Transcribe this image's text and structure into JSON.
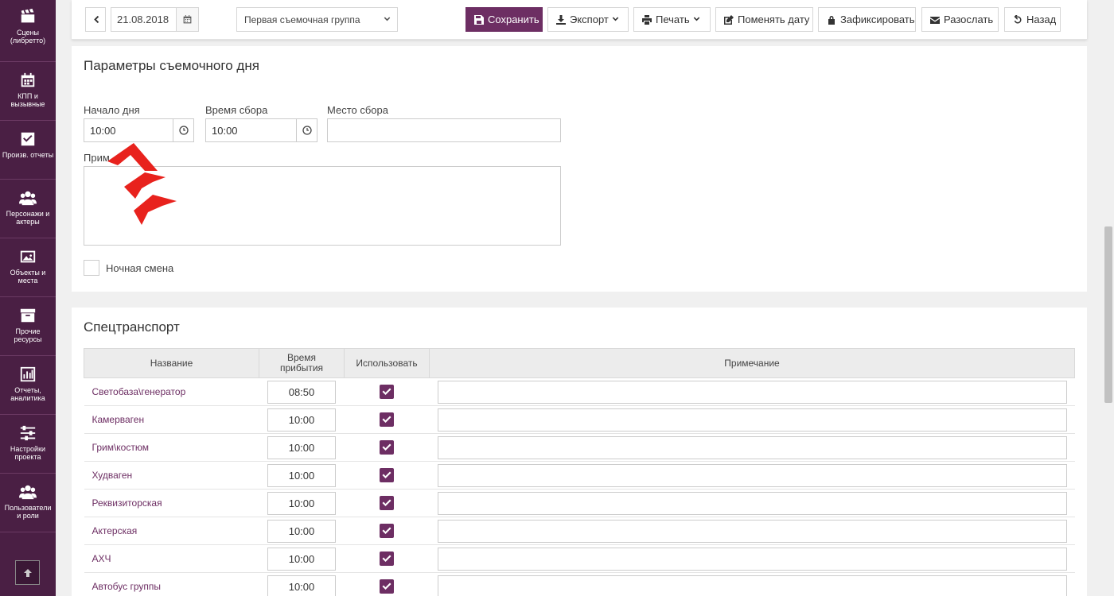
{
  "sidebar": {
    "items": [
      {
        "label": "Сцены (либретто)",
        "icon": "clapperboard-icon"
      },
      {
        "label": "КПП и вызывные",
        "icon": "calendar-icon"
      },
      {
        "label": "Произв. отчеты",
        "icon": "checkbox-icon"
      },
      {
        "label": "Персонажи и актеры",
        "icon": "users-icon"
      },
      {
        "label": "Объекты и места",
        "icon": "picture-icon"
      },
      {
        "label": "Прочие ресурсы",
        "icon": "archive-icon"
      },
      {
        "label": "Отчеты, аналитика",
        "icon": "bar-chart-icon"
      },
      {
        "label": "Настройки проекта",
        "icon": "sliders-icon"
      },
      {
        "label": "Пользователи и роли",
        "icon": "users-icon"
      }
    ]
  },
  "toolbar": {
    "date": "21.08.2018",
    "group": "Первая съемочная группа",
    "save": "Сохранить",
    "export": "Экспорт",
    "print": "Печать",
    "change_date": "Поменять дату",
    "lock": "Зафиксировать",
    "send": "Разослать",
    "back": "Назад"
  },
  "params": {
    "title": "Параметры съемочного дня",
    "start_label": "Начало дня",
    "start_value": "10:00",
    "gather_label": "Время сбора",
    "gather_value": "10:00",
    "place_label": "Место сбора",
    "place_value": "",
    "note_label": "Прим",
    "night_shift": "Ночная смена"
  },
  "transport": {
    "title": "Спецтранспорт",
    "columns": [
      "Название",
      "Время прибытия",
      "Использовать",
      "Примечание"
    ],
    "rows": [
      {
        "name": "Светобаза\\генератор",
        "time": "08:50",
        "use": true
      },
      {
        "name": "Камерваген",
        "time": "10:00",
        "use": true
      },
      {
        "name": "Грим\\костюм",
        "time": "10:00",
        "use": true
      },
      {
        "name": "Худваген",
        "time": "10:00",
        "use": true
      },
      {
        "name": "Реквизиторская",
        "time": "10:00",
        "use": true
      },
      {
        "name": "Актерская",
        "time": "10:00",
        "use": true
      },
      {
        "name": "АХЧ",
        "time": "10:00",
        "use": true
      },
      {
        "name": "Автобус группы",
        "time": "10:00",
        "use": true
      }
    ]
  },
  "colors": {
    "accent": "#6d2e63",
    "sidebar": "#4a1f44",
    "cursor": "#e8221d"
  }
}
